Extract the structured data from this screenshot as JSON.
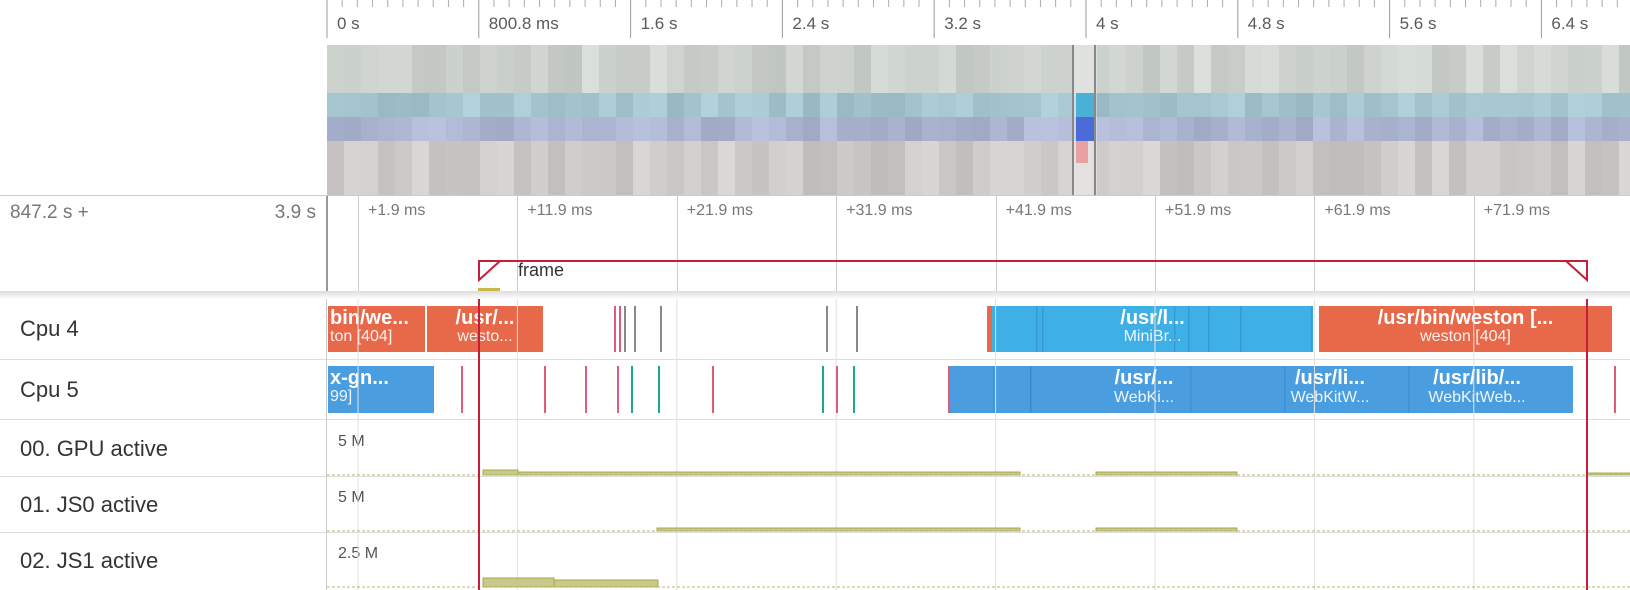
{
  "overview": {
    "labels": [
      "0 s",
      "800.8 ms",
      "1.6 s",
      "2.4 s",
      "3.2 s",
      "4 s",
      "4.8 s",
      "5.6 s",
      "6.4 s"
    ]
  },
  "selection": {
    "offset_label": "847.2 s +",
    "duration_label": "3.9 s",
    "ticks": [
      "+1.9 ms",
      "+11.9 ms",
      "+21.9 ms",
      "+31.9 ms",
      "+41.9 ms",
      "+51.9 ms",
      "+61.9 ms",
      "+71.9 ms"
    ],
    "marker_label": "frame"
  },
  "tracks": {
    "cpu4": {
      "label": "Cpu 4",
      "slices": [
        {
          "t1": "bin/we...",
          "t2": "ton [404]"
        },
        {
          "t1": "/usr/...",
          "t2": "westo..."
        },
        {
          "t1": "/usr/l...",
          "t2": "MiniBr..."
        },
        {
          "t1": "/usr/bin/weston [...",
          "t2": "weston [404]"
        }
      ]
    },
    "cpu5": {
      "label": "Cpu 5",
      "slices": [
        {
          "t1": "x-gn...",
          "t2": "99]"
        },
        {
          "t1": "/usr/...",
          "t2": "WebKi..."
        },
        {
          "t1": "/usr/li...",
          "t2": "WebKitW..."
        },
        {
          "t1": "/usr/lib/...",
          "t2": "WebKitWeb..."
        }
      ]
    },
    "gpu": {
      "label": "00. GPU active",
      "max": "5 M"
    },
    "js0": {
      "label": "01. JS0 active",
      "max": "5 M"
    },
    "js1": {
      "label": "02. JS1 active",
      "max": "2.5 M"
    }
  },
  "colors": {
    "orange": "#e8694a",
    "blue": "#4a9ee0",
    "lightblue": "#3eb0e6",
    "counter": "#c9c98a",
    "marker": "#c41e3a"
  }
}
